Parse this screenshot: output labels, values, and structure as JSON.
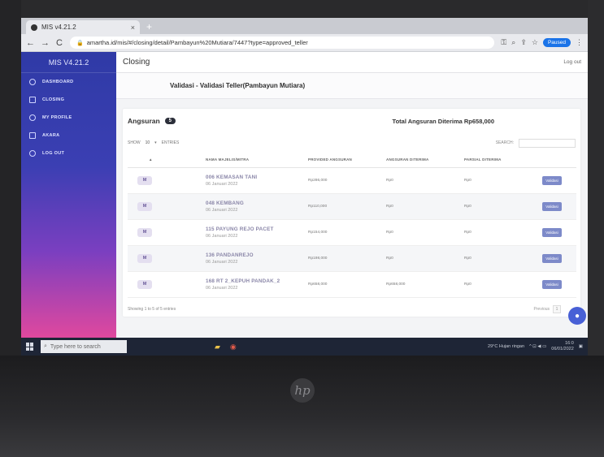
{
  "browser": {
    "tab_title": "MIS v4.21.2",
    "tab_close": "×",
    "new_tab": "+",
    "url": "amartha.id/mis/#/closing/detail/Pambayun%20Mutiara/7447?type=approved_teller",
    "profile_label": "Paused"
  },
  "sidebar": {
    "brand": "MIS V4.21.2",
    "items": [
      {
        "label": "DASHBOARD",
        "icon": "circle-icon"
      },
      {
        "label": "CLOSING",
        "icon": "layers-icon"
      },
      {
        "label": "MY PROFILE",
        "icon": "user-icon"
      },
      {
        "label": "AKARA",
        "icon": "grid-icon"
      },
      {
        "label": "LOG OUT",
        "icon": "power-icon"
      }
    ]
  },
  "header": {
    "title": "Closing",
    "logout": "Log out"
  },
  "page": {
    "validasi_title": "Validasi - Validasi Teller(Pambayun Mutiara)"
  },
  "card": {
    "title": "Angsuran",
    "count": "5",
    "total_label": "Total Angsuran Diterima Rp658,000",
    "show_label": "SHOW",
    "show_value": "10",
    "entries_label": "ENTRIES",
    "search_label": "SEARCH:",
    "columns": [
      "NAMA MAJELIS/MITRA",
      "PROVIDED ANGSURAN",
      "ANGSURAN DITERIMA",
      "PARSIAL DITERIMA",
      ""
    ],
    "rows": [
      {
        "badge": "M",
        "name": "006 KEMASAN TANI",
        "date": "06 Januari 2022",
        "provided": "Rp286,000",
        "received": "Rp0",
        "partial": "Rp0",
        "action": "Validasi"
      },
      {
        "badge": "M",
        "name": "048 KEMBANG",
        "date": "06 Januari 2022",
        "provided": "Rp110,000",
        "received": "Rp0",
        "partial": "Rp0",
        "action": "Validasi"
      },
      {
        "badge": "M",
        "name": "115 PAYUNG REJO PACET",
        "date": "06 Januari 2022",
        "provided": "Rp154,000",
        "received": "Rp0",
        "partial": "Rp0",
        "action": "Validasi"
      },
      {
        "badge": "M",
        "name": "136 PANDANREJO",
        "date": "06 Januari 2022",
        "provided": "Rp198,000",
        "received": "Rp0",
        "partial": "Rp0",
        "action": "Validasi"
      },
      {
        "badge": "M",
        "name": "168 RT 2_KEPUH PANDAK_2",
        "date": "06 Januari 2022",
        "provided": "Rp658,000",
        "received": "Rp658,000",
        "partial": "Rp0",
        "action": "Validasi"
      }
    ],
    "footer": "Showing 1 to 5 of 5 entries",
    "prev_label": "Previous",
    "page_number": "1"
  },
  "taskbar": {
    "search_placeholder": "Type here to search",
    "weather": "29°C Hujan ringan",
    "time": "16:0",
    "date": "06/01/2022"
  }
}
